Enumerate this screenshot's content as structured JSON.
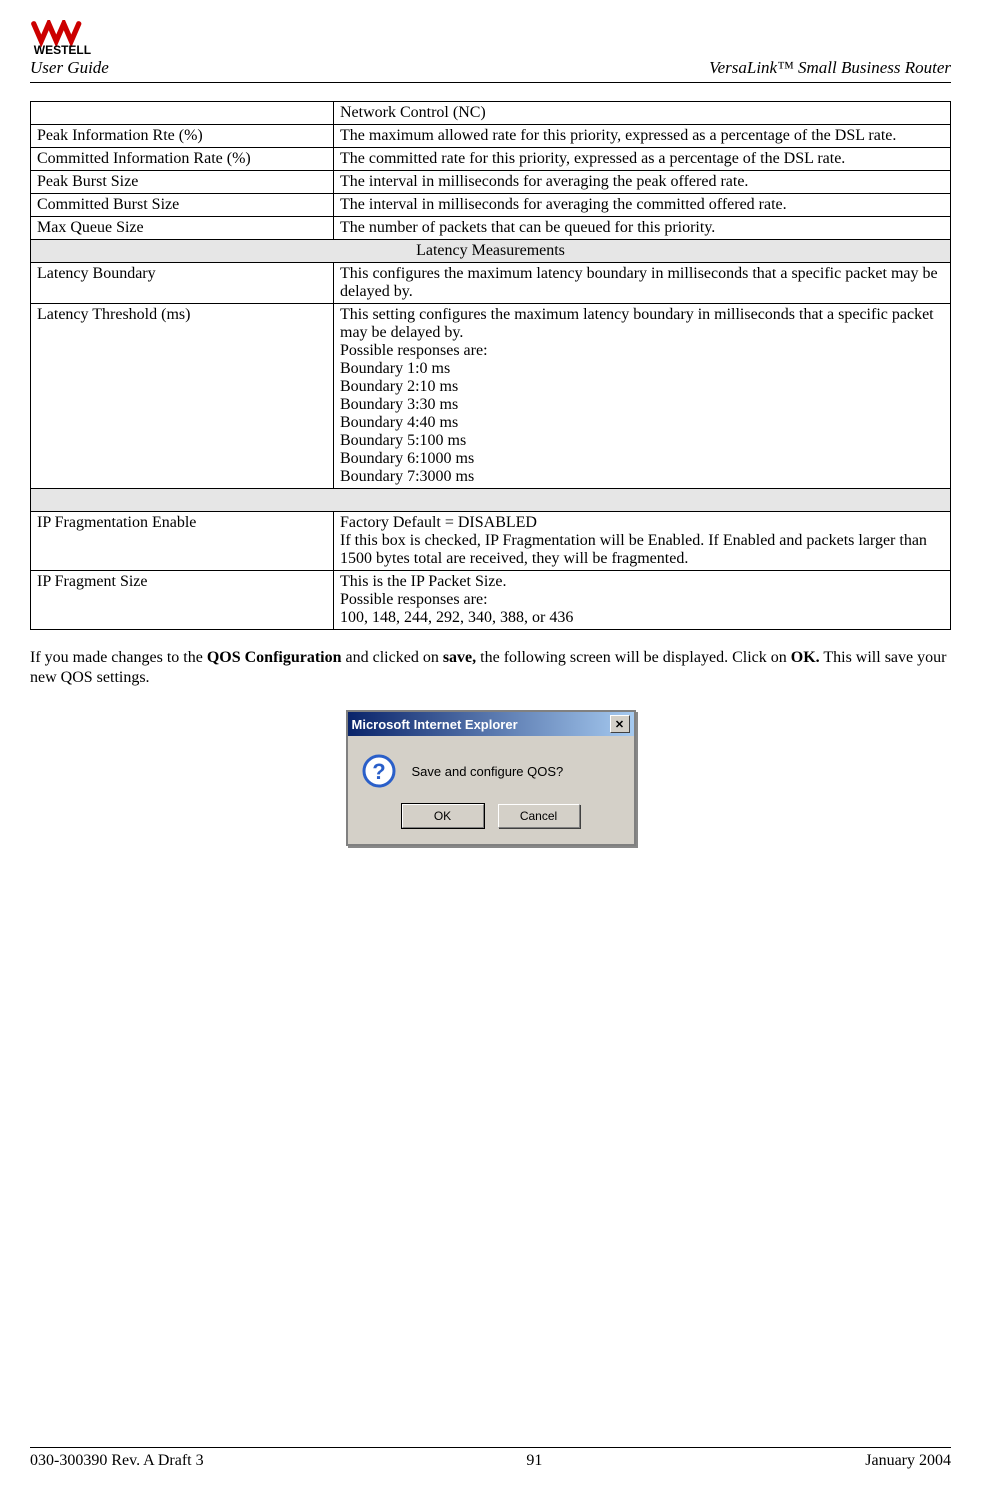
{
  "header": {
    "logo_text": "WESTELL",
    "user_guide": "User Guide",
    "product": "VersaLink™  Small Business Router"
  },
  "table": {
    "rows1": [
      {
        "label": "",
        "desc": "Network Control (NC)"
      },
      {
        "label": "Peak Information Rte (%)",
        "desc": "The maximum allowed rate for this priority, expressed as a percentage of the DSL rate."
      },
      {
        "label": "Committed Information Rate (%)",
        "desc": "The committed rate for this priority, expressed as a percentage of the DSL rate."
      },
      {
        "label": "Peak Burst Size",
        "desc": "The interval in milliseconds for averaging the peak offered rate."
      },
      {
        "label": "Committed Burst Size",
        "desc": "The interval in milliseconds for averaging the committed offered rate."
      },
      {
        "label": "Max Queue Size",
        "desc": "The number of packets that can be queued for this priority."
      }
    ],
    "section_header": "Latency Measurements",
    "rows2": [
      {
        "label": "Latency Boundary",
        "desc": "This configures the maximum latency boundary in milliseconds that a specific packet may be delayed by."
      },
      {
        "label": "Latency Threshold (ms)",
        "desc": "This setting configures the maximum latency boundary in milliseconds that a specific packet may be delayed by.\nPossible responses are:\nBoundary 1:0 ms\nBoundary 2:10 ms\nBoundary 3:30 ms\nBoundary 4:40 ms\nBoundary 5:100 ms\nBoundary 6:1000 ms\nBoundary 7:3000 ms"
      }
    ],
    "rows3": [
      {
        "label": "IP Fragmentation Enable",
        "desc": "Factory Default = DISABLED\nIf this box is checked, IP Fragmentation will be Enabled. If Enabled and packets larger than 1500 bytes total are received, they will be fragmented."
      },
      {
        "label": "IP Fragment Size",
        "desc": "This is the IP Packet Size.\nPossible responses are:\n100, 148, 244, 292, 340, 388, or 436"
      }
    ]
  },
  "para": {
    "t1": "If you made changes to the ",
    "b1": "QOS Configuration",
    "t2": " and clicked on ",
    "b2": "save,",
    "t3": " the following screen will be displayed. Click on ",
    "b3": "OK.",
    "t4": " This will save your new QOS settings."
  },
  "dialog": {
    "title": "Microsoft Internet Explorer",
    "message": "Save and configure QOS?",
    "ok_label": "OK",
    "cancel_label": "Cancel"
  },
  "footer": {
    "left": "030-300390 Rev. A Draft 3",
    "center": "91",
    "right": "January 2004"
  }
}
